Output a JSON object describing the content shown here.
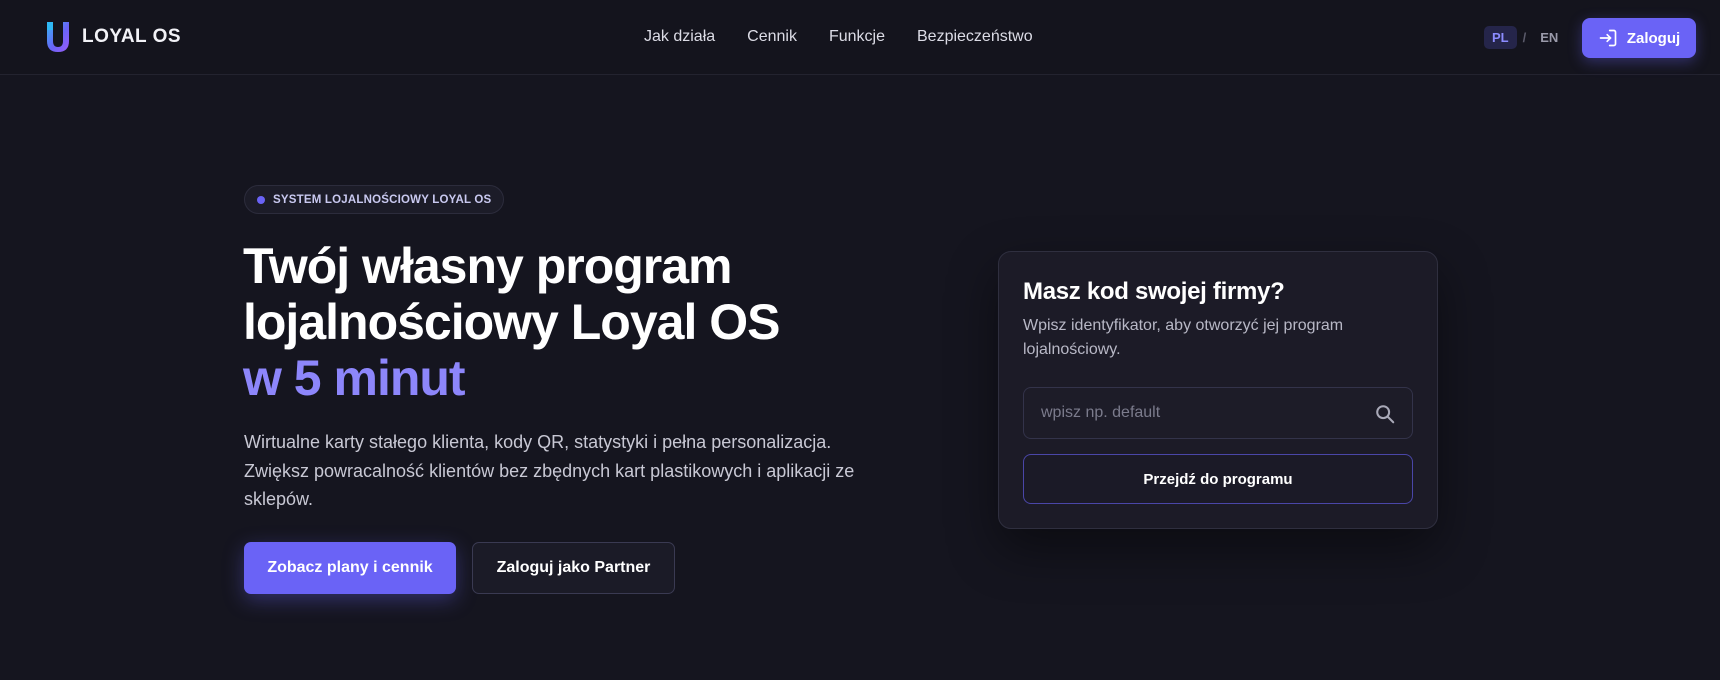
{
  "brand": {
    "name": "LOYAL OS"
  },
  "nav": {
    "items": [
      "Jak działa",
      "Cennik",
      "Funkcje",
      "Bezpieczeństwo"
    ]
  },
  "lang": {
    "active": "PL",
    "separator": "/",
    "other": "EN"
  },
  "header": {
    "login_label": "Zaloguj"
  },
  "hero": {
    "badge": "SYSTEM LOJALNOŚCIOWY LOYAL OS",
    "title_line1": "Twój własny program",
    "title_line2": "lojalnościowy Loyal OS",
    "title_accent": "w 5 minut",
    "description": "Wirtualne karty stałego klienta, kody QR, statystyki i pełna personalizacja. Zwiększ powracalność klientów bez zbędnych kart plastikowych i aplikacji ze sklepów.",
    "primary_button": "Zobacz plany i cennik",
    "secondary_button": "Zaloguj jako Partner"
  },
  "card": {
    "title": "Masz kod swojej firmy?",
    "subtitle": "Wpisz identyfikator, aby otworzyć jej program lojalnościowy.",
    "input_placeholder": "wpisz np. default",
    "input_value": "",
    "button": "Przejdź do programu"
  },
  "colors": {
    "accent": "#6a63f6",
    "accent_text": "#8d86fb",
    "background": "#15151f"
  },
  "icons": {
    "logo": "loyal-os-logo-icon",
    "login": "login-arrow-icon",
    "search": "search-icon"
  }
}
